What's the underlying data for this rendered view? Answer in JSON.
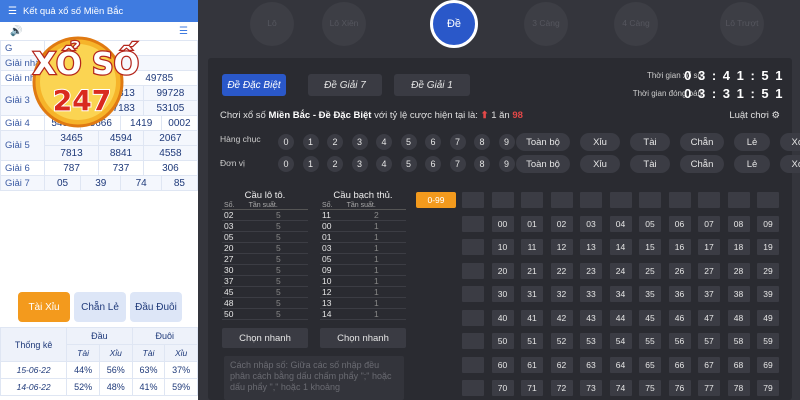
{
  "left": {
    "header_title": "Kết quả xổ số Miền Bắc",
    "prize_labels": [
      "G",
      "Giải nhất",
      "Giải nhì",
      "Giải 3",
      "Giải 4",
      "Giải 5",
      "Giải 6",
      "Giải 7"
    ],
    "prizes": [
      {
        "label": "G",
        "rows": [
          [
            ""
          ]
        ]
      },
      {
        "label": "Giải nhất",
        "rows": [
          [
            ""
          ]
        ]
      },
      {
        "label": "Giải nhì",
        "rows": [
          [
            "00155",
            "49785"
          ]
        ]
      },
      {
        "label": "Giải 3",
        "rows": [
          [
            "58893",
            "62313",
            "99728"
          ],
          [
            "02338",
            "97183",
            "53105"
          ]
        ]
      },
      {
        "label": "Giải 4",
        "rows": [
          [
            "5498",
            "5666",
            "1419",
            "0002"
          ]
        ]
      },
      {
        "label": "Giải 5",
        "rows": [
          [
            "3465",
            "4594",
            "2067"
          ],
          [
            "7813",
            "8841",
            "4558"
          ]
        ]
      },
      {
        "label": "Giải 6",
        "rows": [
          [
            "787",
            "737",
            "306"
          ]
        ]
      },
      {
        "label": "Giải 7",
        "rows": [
          [
            "05",
            "39",
            "74",
            "85"
          ]
        ]
      }
    ],
    "logo_text_1": "XỔ SỐ",
    "logo_text_2": "247",
    "tabs": [
      "Tài Xỉu",
      "Chẵn Lẻ",
      "Đầu Đuôi"
    ],
    "stats": {
      "title": "Thống kê",
      "head_col": "Đầu",
      "tail_col": "Đuôi",
      "sub": [
        "Tài",
        "Xỉu",
        "Tài",
        "Xỉu"
      ],
      "rows": [
        {
          "date": "15-06-22",
          "vals": [
            "44%",
            "56%",
            "63%",
            "37%"
          ]
        },
        {
          "date": "14-06-22",
          "vals": [
            "52%",
            "48%",
            "41%",
            "59%"
          ]
        }
      ]
    }
  },
  "top_tabs": [
    "Lô",
    "Lô Xiên",
    "Đề",
    "3 Càng",
    "4 Càng",
    "Lô Trượt"
  ],
  "bet_tabs": [
    "Đề Đặc Biệt",
    "Đề Giải 7",
    "Đề Giải 1"
  ],
  "timers": {
    "label1": "Thời gian xổ số",
    "value1": "0 3 : 4 1 : 5 1",
    "label2": "Thời gian đóng bán",
    "value2": "0 3 : 3 1 : 5 1"
  },
  "rate_line": {
    "prefix": "Chơi xổ số",
    "region": "Miền Bắc",
    "dash": "-",
    "type": "Đề Đặc Biệt",
    "suffix": "với tỷ lệ cược hiện tại là:",
    "rate_a": "1 ăn",
    "rate_b": "98"
  },
  "rules_label": "Luật chơi",
  "row_labels": [
    "Hàng chục",
    "Đơn vị"
  ],
  "digits": [
    "0",
    "1",
    "2",
    "3",
    "4",
    "5",
    "6",
    "7",
    "8",
    "9"
  ],
  "quick_buttons": [
    "Toàn bộ",
    "Xỉu",
    "Tài",
    "Chẵn",
    "Lẻ",
    "Xóa"
  ],
  "lo_freq": {
    "title": "Cầu lô tô.",
    "col1": "Số.",
    "col2": "Tần suất.",
    "rows": [
      [
        "02",
        "5"
      ],
      [
        "03",
        "5"
      ],
      [
        "05",
        "5"
      ],
      [
        "20",
        "5"
      ],
      [
        "27",
        "5"
      ],
      [
        "30",
        "5"
      ],
      [
        "37",
        "5"
      ],
      [
        "45",
        "5"
      ],
      [
        "48",
        "5"
      ],
      [
        "50",
        "5"
      ]
    ]
  },
  "bach_freq": {
    "title": "Cầu bạch thủ.",
    "col1": "Số.",
    "col2": "Tần suất.",
    "rows": [
      [
        "11",
        "2"
      ],
      [
        "00",
        "1"
      ],
      [
        "01",
        "1"
      ],
      [
        "03",
        "1"
      ],
      [
        "05",
        "1"
      ],
      [
        "09",
        "1"
      ],
      [
        "10",
        "1"
      ],
      [
        "12",
        "1"
      ],
      [
        "13",
        "1"
      ],
      [
        "14",
        "1"
      ]
    ]
  },
  "quick_select": "Chọn nhanh",
  "range_button": "0-99",
  "note": "Cách nhập số: Giữa các số nhập đều phân cách bằng dấu chấm phẩy \";\" hoặc dấu phẩy \",\" hoặc 1 khoảng",
  "number_grid": {
    "header_row": [
      "",
      "",
      "",
      "",
      "",
      "",
      "",
      "",
      "",
      "",
      ""
    ],
    "rows": [
      [
        "",
        "00",
        "01",
        "02",
        "03",
        "04",
        "05",
        "06",
        "07",
        "08",
        "09"
      ],
      [
        "",
        "10",
        "11",
        "12",
        "13",
        "14",
        "15",
        "16",
        "17",
        "18",
        "19"
      ],
      [
        "",
        "20",
        "21",
        "22",
        "23",
        "24",
        "25",
        "26",
        "27",
        "28",
        "29"
      ],
      [
        "",
        "30",
        "31",
        "32",
        "33",
        "34",
        "35",
        "36",
        "37",
        "38",
        "39"
      ],
      [
        "",
        "40",
        "41",
        "42",
        "43",
        "44",
        "45",
        "46",
        "47",
        "48",
        "49"
      ],
      [
        "",
        "50",
        "51",
        "52",
        "53",
        "54",
        "55",
        "56",
        "57",
        "58",
        "59"
      ],
      [
        "",
        "60",
        "61",
        "62",
        "63",
        "64",
        "65",
        "66",
        "67",
        "68",
        "69"
      ],
      [
        "",
        "70",
        "71",
        "72",
        "73",
        "74",
        "75",
        "76",
        "77",
        "78",
        "79"
      ]
    ]
  },
  "colors": {
    "accent": "#2a58c9",
    "orange": "#f39a1d",
    "red": "#e34848",
    "left_header": "#3f7be0"
  }
}
